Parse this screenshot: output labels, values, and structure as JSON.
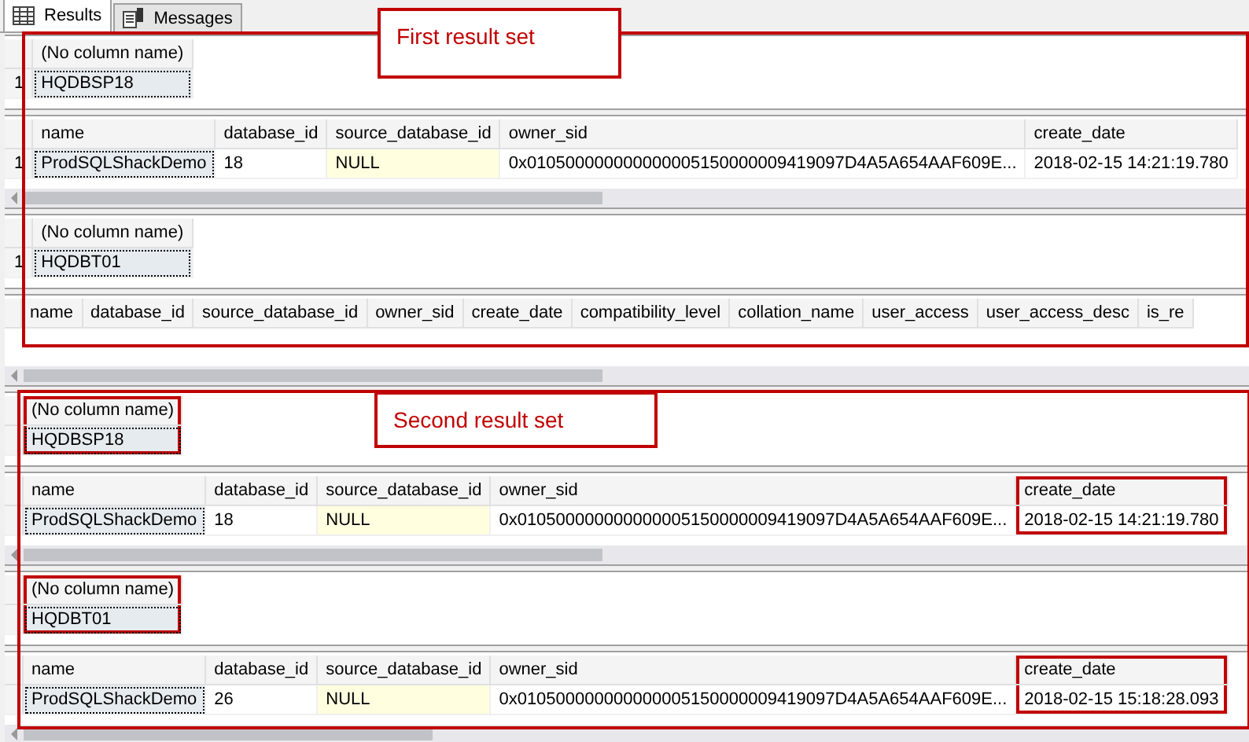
{
  "tabs": [
    {
      "label": "Results",
      "selected": true,
      "kind": "grid"
    },
    {
      "label": "Messages",
      "selected": false,
      "kind": "messages"
    }
  ],
  "grids": [
    {
      "scrollbar": false,
      "columns": [
        {
          "label": "(No column name)",
          "highlighted": false
        }
      ],
      "rows": [
        {
          "row_number": "1",
          "cells": [
            {
              "text": "HQDBSP18",
              "selected": true,
              "null": false
            }
          ]
        }
      ]
    },
    {
      "scrollbar": true,
      "columns": [
        {
          "label": "name",
          "highlighted": false
        },
        {
          "label": "database_id",
          "highlighted": false
        },
        {
          "label": "source_database_id",
          "highlighted": false
        },
        {
          "label": "owner_sid",
          "highlighted": false
        },
        {
          "label": "create_date",
          "highlighted": false
        }
      ],
      "rows": [
        {
          "row_number": "1",
          "cells": [
            {
              "text": "ProdSQLShackDemo",
              "selected": true,
              "null": false
            },
            {
              "text": "18",
              "selected": false,
              "null": false
            },
            {
              "text": "NULL",
              "selected": false,
              "null": true
            },
            {
              "text": "0x010500000000000005150000009419097D4A5A654AAF609E...",
              "selected": false,
              "null": false
            },
            {
              "text": "2018-02-15 14:21:19.780",
              "selected": false,
              "null": false
            }
          ]
        }
      ]
    },
    {
      "scrollbar": false,
      "columns": [
        {
          "label": "(No column name)",
          "highlighted": false
        }
      ],
      "rows": [
        {
          "row_number": "1",
          "cells": [
            {
              "text": "HQDBT01",
              "selected": true,
              "null": false
            }
          ]
        }
      ]
    },
    {
      "scrollbar": true,
      "columns": [
        {
          "label": "name",
          "highlighted": false
        },
        {
          "label": "database_id",
          "highlighted": false
        },
        {
          "label": "source_database_id",
          "highlighted": false
        },
        {
          "label": "owner_sid",
          "highlighted": false
        },
        {
          "label": "create_date",
          "highlighted": false
        },
        {
          "label": "compatibility_level",
          "highlighted": false
        },
        {
          "label": "collation_name",
          "highlighted": false
        },
        {
          "label": "user_access",
          "highlighted": false
        },
        {
          "label": "user_access_desc",
          "highlighted": false
        },
        {
          "label": "is_re",
          "highlighted": false
        }
      ]
    },
    {
      "scrollbar": false,
      "columns": [
        {
          "label": "(No column name)",
          "highlighted": true
        }
      ],
      "rows": [
        {
          "cells": [
            {
              "text": "HQDBSP18",
              "selected": true,
              "null": false
            }
          ]
        }
      ]
    },
    {
      "scrollbar": true,
      "columns": [
        {
          "label": "name",
          "highlighted": false
        },
        {
          "label": "database_id",
          "highlighted": false
        },
        {
          "label": "source_database_id",
          "highlighted": false
        },
        {
          "label": "owner_sid",
          "highlighted": false
        },
        {
          "label": "create_date",
          "highlighted": true
        }
      ],
      "rows": [
        {
          "cells": [
            {
              "text": "ProdSQLShackDemo",
              "selected": true,
              "null": false
            },
            {
              "text": "18",
              "selected": false,
              "null": false
            },
            {
              "text": "NULL",
              "selected": false,
              "null": true
            },
            {
              "text": "0x010500000000000005150000009419097D4A5A654AAF609E...",
              "selected": false,
              "null": false
            },
            {
              "text": "2018-02-15 14:21:19.780",
              "selected": false,
              "null": false
            }
          ]
        }
      ]
    },
    {
      "scrollbar": false,
      "columns": [
        {
          "label": "(No column name)",
          "highlighted": true
        }
      ],
      "rows": [
        {
          "cells": [
            {
              "text": "HQDBT01",
              "selected": true,
              "null": false
            }
          ]
        }
      ]
    },
    {
      "scrollbar": true,
      "columns": [
        {
          "label": "name",
          "highlighted": false
        },
        {
          "label": "database_id",
          "highlighted": false
        },
        {
          "label": "source_database_id",
          "highlighted": false
        },
        {
          "label": "owner_sid",
          "highlighted": false
        },
        {
          "label": "create_date",
          "highlighted": true
        }
      ],
      "rows": [
        {
          "cells": [
            {
              "text": "ProdSQLShackDemo",
              "selected": true,
              "null": false
            },
            {
              "text": "26",
              "selected": false,
              "null": false
            },
            {
              "text": "NULL",
              "selected": false,
              "null": true
            },
            {
              "text": "0x010500000000000005150000009419097D4A5A654AAF609E...",
              "selected": false,
              "null": false
            },
            {
              "text": "2018-02-15 15:18:28.093",
              "selected": false,
              "null": false
            }
          ]
        }
      ]
    }
  ],
  "annotations": [
    {
      "text": "First result set"
    },
    {
      "text": "Second result set"
    }
  ]
}
